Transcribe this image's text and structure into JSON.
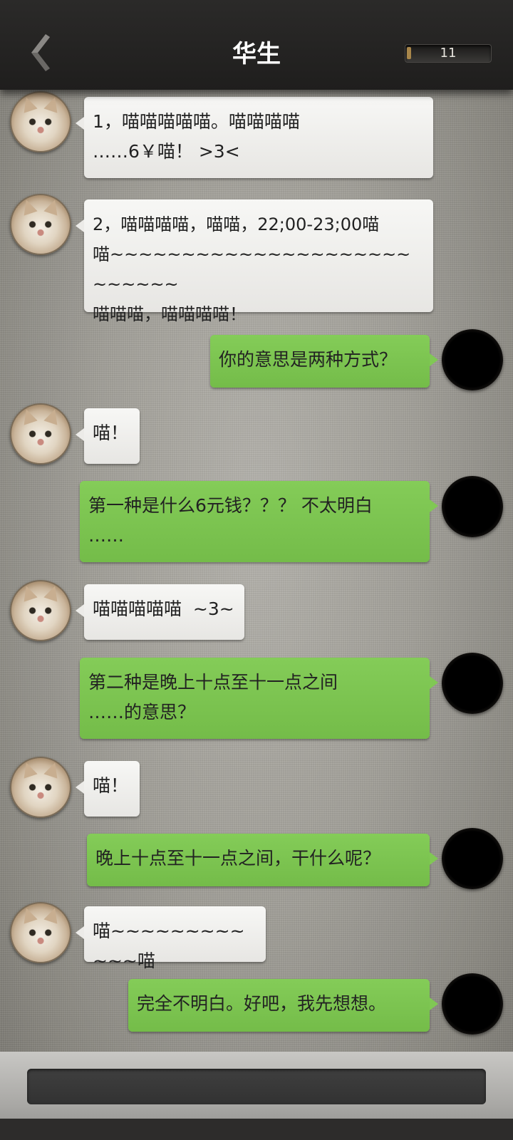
{
  "header": {
    "title": "华生",
    "counter": "11",
    "counter_progress": 0.05
  },
  "messages": [
    {
      "side": "left",
      "text": "1，喵喵喵喵喵。喵喵喵喵\n……6￥喵！ >3<"
    },
    {
      "side": "left",
      "text": "2，喵喵喵喵，喵喵，22;00-23;00喵\n喵~~~~~~~~~~~~~~~~~~~~~~~~~~~\n喵喵喵，喵喵喵喵！"
    },
    {
      "side": "right",
      "text": "你的意思是两种方式？"
    },
    {
      "side": "left",
      "text": "喵！"
    },
    {
      "side": "right",
      "text": "第一种是什么6元钱？？？ 不太明白\n……"
    },
    {
      "side": "left",
      "text": "喵喵喵喵喵  ~3~"
    },
    {
      "side": "right",
      "text": "第二种是晚上十点至十一点之间\n……的意思？"
    },
    {
      "side": "left",
      "text": "喵！"
    },
    {
      "side": "right",
      "text": "晚上十点至十一点之间，干什么呢？"
    },
    {
      "side": "left",
      "text": "喵~~~~~~~~~~~~喵"
    },
    {
      "side": "right",
      "text": "完全不明白。好吧，我先想想。"
    }
  ],
  "footer": {
    "input_placeholder": ""
  }
}
